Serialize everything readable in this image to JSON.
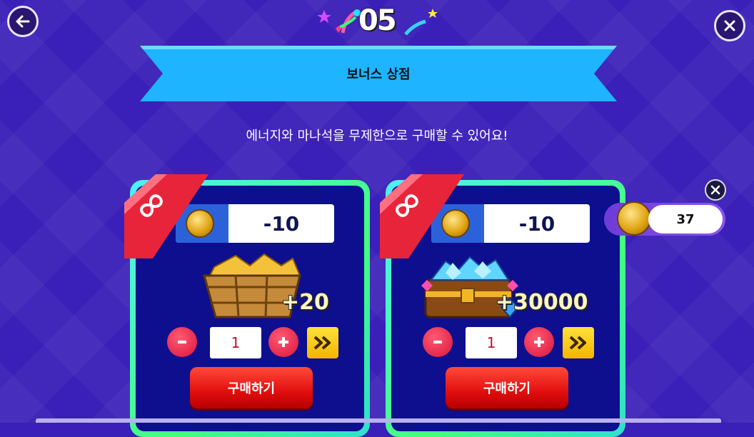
{
  "header": {
    "event_number": "05",
    "banner_title": "보너스 상점",
    "subtitle": "에너지와 마나석을 무제한으로 구매할 수 있어요!"
  },
  "icons": {
    "back": "arrow-left-icon",
    "close": "close-icon",
    "ribbon": "infinity-icon",
    "currency": "coin-icon",
    "minus": "minus-icon",
    "plus": "plus-icon",
    "max": "double-chevron-right-icon"
  },
  "products": [
    {
      "price": "-10",
      "item": "energy-crate",
      "bonus": "+20",
      "quantity": "1",
      "buy_label": "구매하기"
    },
    {
      "price": "-10",
      "item": "mana-stone-chest",
      "bonus": "+30000",
      "quantity": "1",
      "buy_label": "구매하기"
    }
  ],
  "wallet": {
    "coins": "37"
  },
  "colors": {
    "background": "#3a1fb8",
    "banner": "#1eb4ff",
    "card_border": "#44ff7a",
    "card_inner": "#0d0f8f",
    "buy_button": "#e10e0e",
    "ribbon": "#e8243a"
  }
}
